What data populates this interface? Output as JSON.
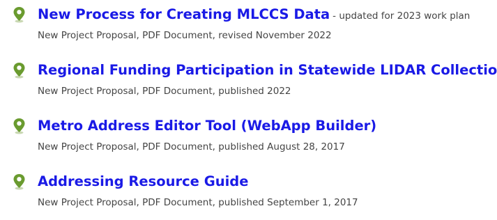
{
  "items": [
    {
      "icon": "map-pin-icon",
      "title": "New Process for Creating MLCCS Data",
      "note": "- updated for 2023 work plan",
      "meta": "New Project Proposal, PDF Document, revised November 2022"
    },
    {
      "icon": "map-pin-icon",
      "title": "Regional Funding Participation in Statewide LIDAR Collection",
      "note": "",
      "meta": "New Project Proposal, PDF Document, published 2022"
    },
    {
      "icon": "map-pin-icon",
      "title": "Metro Address Editor Tool (WebApp Builder)",
      "note": "",
      "meta": "New Project Proposal, PDF Document, published August 28, 2017"
    },
    {
      "icon": "map-pin-icon",
      "title": "Addressing Resource Guide",
      "note": "",
      "meta": "New Project Proposal, PDF Document, published September 1, 2017"
    }
  ],
  "colors": {
    "link": "#1a1ae6",
    "meta_text": "#444444",
    "pin": "#6a9b2f"
  }
}
